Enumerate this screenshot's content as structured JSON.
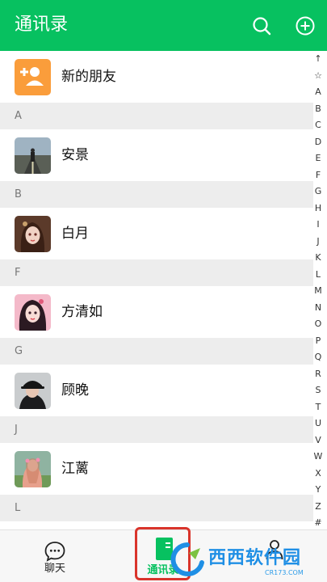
{
  "header": {
    "title": "通讯录",
    "search_icon": "search-icon",
    "add_icon": "add-circle-icon",
    "color": "#07c160"
  },
  "new_friends": {
    "label": "新的朋友",
    "icon": "add-friend-icon",
    "icon_color": "#fa9d3b"
  },
  "sections": [
    {
      "letter": "A",
      "contacts": [
        {
          "name": "安景"
        }
      ]
    },
    {
      "letter": "B",
      "contacts": [
        {
          "name": "白月"
        }
      ]
    },
    {
      "letter": "F",
      "contacts": [
        {
          "name": "方清如"
        }
      ]
    },
    {
      "letter": "G",
      "contacts": [
        {
          "name": "顾晚"
        }
      ]
    },
    {
      "letter": "J",
      "contacts": [
        {
          "name": "江蓠"
        }
      ]
    },
    {
      "letter": "L",
      "contacts": []
    }
  ],
  "index_bar": [
    "↑",
    "☆",
    "A",
    "B",
    "C",
    "D",
    "E",
    "F",
    "G",
    "H",
    "I",
    "J",
    "K",
    "L",
    "M",
    "N",
    "O",
    "P",
    "Q",
    "R",
    "S",
    "T",
    "U",
    "V",
    "W",
    "X",
    "Y",
    "Z",
    "#"
  ],
  "tabbar": {
    "chat": {
      "label": "聊天",
      "icon": "chat-bubble-icon"
    },
    "contacts": {
      "label": "通讯录",
      "icon": "contacts-icon",
      "active_color": "#07c160"
    },
    "me": {
      "icon": "person-icon"
    }
  },
  "watermark": {
    "text": "西西软件园",
    "sub": "CR173.COM"
  }
}
